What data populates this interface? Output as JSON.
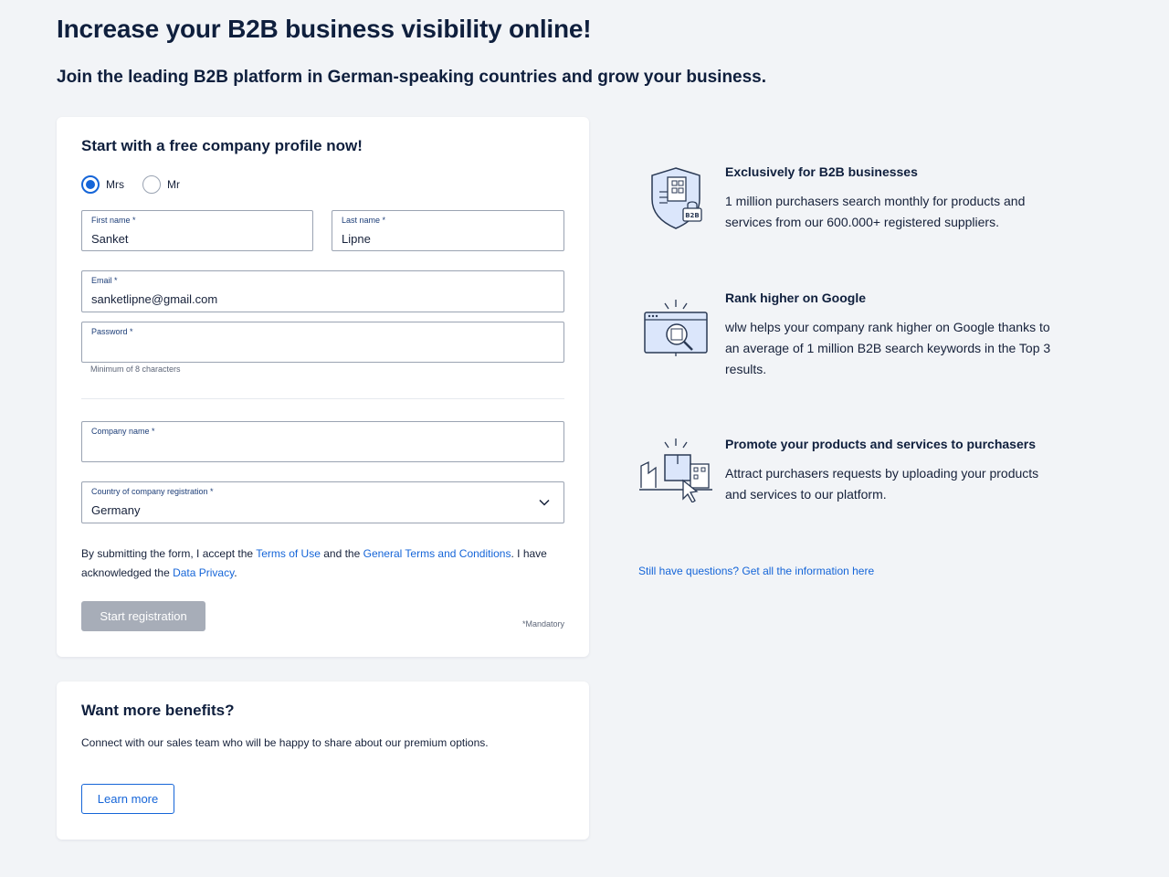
{
  "header": {
    "title": "Increase your B2B business visibility online!",
    "subtitle": "Join the leading B2B platform in German-speaking countries and grow your business."
  },
  "form": {
    "title": "Start with a free company profile now!",
    "salutation": {
      "options": [
        "Mrs",
        "Mr"
      ],
      "selected": "Mrs"
    },
    "first_name": {
      "label": "First name *",
      "value": "Sanket"
    },
    "last_name": {
      "label": "Last name *",
      "value": "Lipne"
    },
    "email": {
      "label": "Email *",
      "value": "sanketlipne@gmail.com"
    },
    "password": {
      "label": "Password *",
      "value": "",
      "hint": "Minimum of 8 characters"
    },
    "company_name": {
      "label": "Company name *",
      "value": ""
    },
    "country": {
      "label": "Country of company registration *",
      "value": "Germany"
    },
    "terms": {
      "part1": "By submitting the form, I accept the ",
      "link_terms_of_use": "Terms of Use",
      "part2": " and the ",
      "link_general_terms": "General Terms and Conditions",
      "part3": ". I have acknowledged the ",
      "link_privacy": "Data Privacy",
      "part4": "."
    },
    "submit_label": "Start registration",
    "mandatory_note": "*Mandatory"
  },
  "benefits": {
    "title": "Want more benefits?",
    "text": "Connect with our sales team who will be happy to share about our premium options.",
    "button_label": "Learn more"
  },
  "features": [
    {
      "icon": "b2b-shield-icon",
      "title": "Exclusively for B2B businesses",
      "text": "1 million purchasers search monthly for products and services from our 600.000+ registered suppliers."
    },
    {
      "icon": "search-ranking-icon",
      "title": "Rank higher on Google",
      "text": "wlw helps your company rank higher on Google thanks to an average of 1 million B2B search keywords in the Top 3 results."
    },
    {
      "icon": "promote-products-icon",
      "title": "Promote your products and services to purchasers",
      "text": "Attract purchasers requests by uploading your products and services to our platform."
    }
  ],
  "questions_link": "Still have questions? Get all the information here",
  "colors": {
    "accent": "#1565d8",
    "background": "#f2f4f7",
    "heading": "#0f1f3d",
    "disabled_button": "#a7adb8"
  }
}
